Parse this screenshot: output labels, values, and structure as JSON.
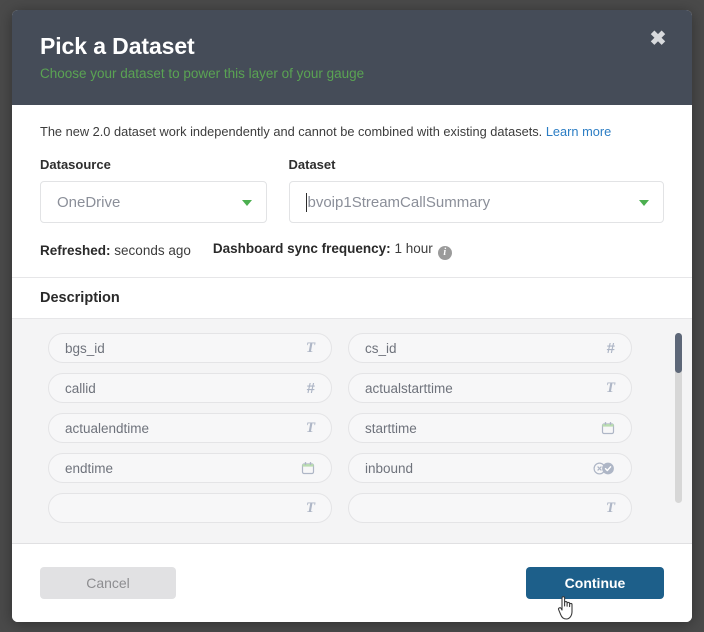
{
  "header": {
    "title": "Pick a Dataset",
    "subtitle": "Choose your dataset to power this layer of your gauge",
    "close_icon": "close-icon",
    "close_glyph": "✖",
    "bg_color": "#454c58",
    "subtitle_color": "#5aa353"
  },
  "notice": {
    "text": "The new 2.0 dataset work independently and cannot be combined with existing datasets.",
    "link_label": "Learn more",
    "link_color": "#2b7dc4"
  },
  "datasource": {
    "label": "Datasource",
    "value": "OneDrive",
    "caret_icon": "chevron-down-icon"
  },
  "dataset": {
    "label": "Dataset",
    "value": "bvoip1StreamCallSummary",
    "caret_icon": "chevron-down-icon"
  },
  "meta": {
    "refreshed_label": "Refreshed:",
    "refreshed_value": "seconds ago",
    "sync_label": "Dashboard sync frequency:",
    "sync_value": "1 hour",
    "info_icon": "info-icon",
    "info_glyph": "i"
  },
  "description": {
    "section_title": "Description",
    "fields": [
      {
        "name": "bgs_id",
        "type": "text",
        "icon": "text-type-icon"
      },
      {
        "name": "cs_id",
        "type": "number",
        "icon": "number-type-icon"
      },
      {
        "name": "callid",
        "type": "number",
        "icon": "number-type-icon"
      },
      {
        "name": "actualstarttime",
        "type": "text",
        "icon": "text-type-icon"
      },
      {
        "name": "actualendtime",
        "type": "text",
        "icon": "text-type-icon"
      },
      {
        "name": "starttime",
        "type": "date",
        "icon": "calendar-type-icon"
      },
      {
        "name": "endtime",
        "type": "date",
        "icon": "calendar-type-icon"
      },
      {
        "name": "inbound",
        "type": "boolean",
        "icon": "boolean-type-icon"
      },
      {
        "name": "",
        "type": "text",
        "icon": "text-type-icon"
      },
      {
        "name": "",
        "type": "text",
        "icon": "text-type-icon"
      }
    ]
  },
  "scrollbar": {
    "name": "chips-scrollbar"
  },
  "footer": {
    "cancel_label": "Cancel",
    "continue_label": "Continue",
    "continue_color": "#1d5f8a"
  }
}
